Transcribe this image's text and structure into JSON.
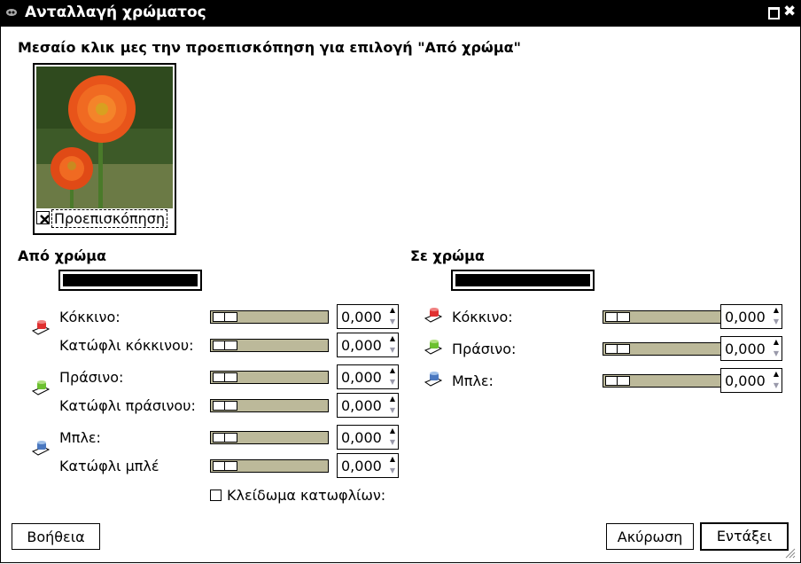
{
  "window": {
    "title": "Ανταλλαγή χρώματος"
  },
  "hint": "Μεσαίο κλικ μες την προεπισκόπηση για επιλογή \"Από χρώμα\"",
  "preview": {
    "label": "Προεπισκόπηση",
    "checked": true
  },
  "from": {
    "title": "Από χρώμα",
    "color": "#000000",
    "rows": [
      {
        "label": "Κόκκινο:",
        "value": "0,000"
      },
      {
        "label": "Κατώφλι κόκκινου:",
        "value": "0,000"
      },
      {
        "label": "Πράσινο:",
        "value": "0,000"
      },
      {
        "label": "Κατώφλι πράσινου:",
        "value": "0,000"
      },
      {
        "label": "Μπλε:",
        "value": "0,000"
      },
      {
        "label": "Κατώφλι μπλέ",
        "value": "0,000"
      }
    ],
    "lock_label": "Κλείδωμα κατωφλίων:"
  },
  "to": {
    "title": "Σε χρώμα",
    "color": "#000000",
    "rows": [
      {
        "label": "Κόκκινο:",
        "value": "0,000"
      },
      {
        "label": "Πράσινο:",
        "value": "0,000"
      },
      {
        "label": "Μπλε:",
        "value": "0,000"
      }
    ]
  },
  "buttons": {
    "help": "Βοήθεια",
    "cancel": "Ακύρωση",
    "ok": "Εντάξει"
  },
  "icons": {
    "red": "#e03030",
    "green": "#6cc030",
    "blue": "#4a78c0"
  }
}
